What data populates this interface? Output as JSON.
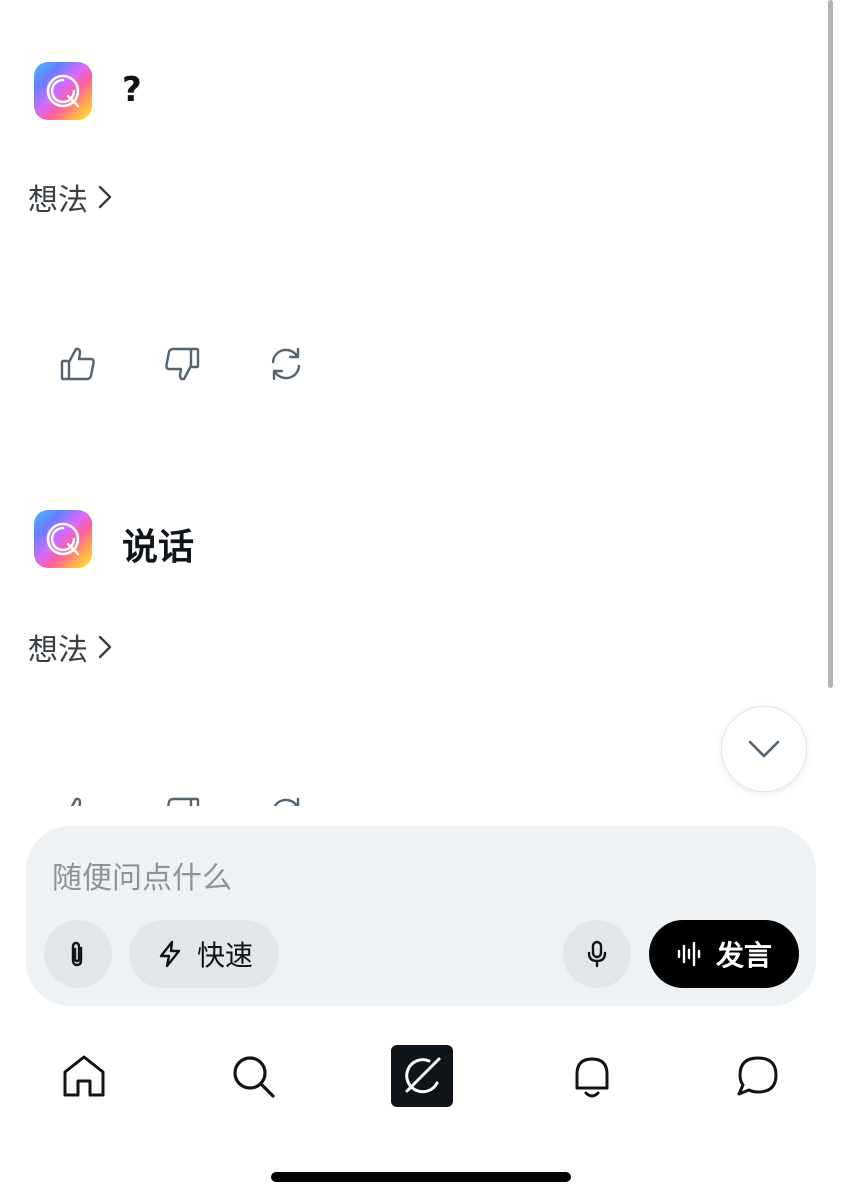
{
  "conversation": {
    "messages": [
      {
        "title": "?",
        "thoughts_label": "想法"
      },
      {
        "title": "说话",
        "thoughts_label": "想法"
      }
    ]
  },
  "composer": {
    "placeholder": "随便问点什么",
    "fast_label": "快速",
    "speak_label": "发言"
  },
  "icons": {
    "avatar": "grok-logo-icon",
    "thoughts_chevron": "chevron-right-icon",
    "like": "thumbs-up-icon",
    "dislike": "thumbs-down-icon",
    "regenerate": "refresh-icon",
    "scroll_down": "chevron-down-icon",
    "attach": "paperclip-icon",
    "fast": "lightning-icon",
    "mic": "microphone-icon",
    "speak": "waveform-icon",
    "nav": [
      "home-icon",
      "search-icon",
      "grok-icon",
      "bell-icon",
      "message-icon"
    ]
  },
  "colors": {
    "accent": "#000000",
    "composer_bg": "#eef2f4",
    "icon_gray": "#536471"
  }
}
